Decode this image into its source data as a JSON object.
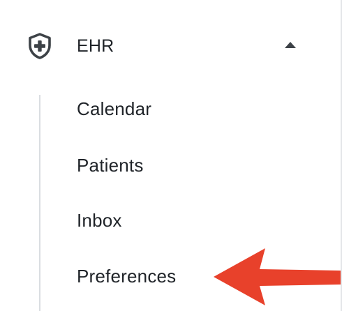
{
  "nav": {
    "group": {
      "label": "EHR",
      "icon": "shield-plus-icon",
      "expanded": true,
      "expand_icon": "chevron-up-icon"
    },
    "items": [
      {
        "label": "Calendar"
      },
      {
        "label": "Patients"
      },
      {
        "label": "Inbox"
      },
      {
        "label": "Preferences"
      }
    ]
  },
  "annotation": {
    "type": "arrow",
    "points_to": "Preferences",
    "color": "#e8412b"
  },
  "colors": {
    "text": "#1f2328",
    "rail": "#dadde1",
    "divider": "#e3e5e8",
    "icon": "#3d4247"
  }
}
